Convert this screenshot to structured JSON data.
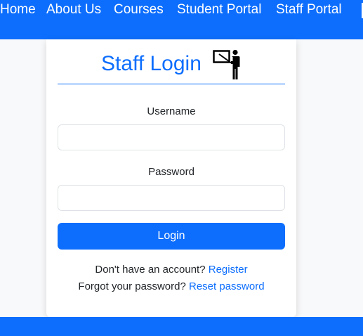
{
  "nav": {
    "items": [
      "Home",
      "About Us",
      "Courses",
      "Student Portal",
      "Staff Portal"
    ]
  },
  "login": {
    "title": "Staff Login",
    "icon": "teacher-at-board-icon",
    "username_label": "Username",
    "username_value": "",
    "password_label": "Password",
    "password_value": "",
    "button_label": "Login",
    "register_prompt": "Don't have an account?",
    "register_link": "Register",
    "forgot_prompt": "Forgot your password?",
    "reset_link": "Reset password"
  },
  "colors": {
    "primary": "#0d6efd",
    "page_bg": "#f8f9fa"
  }
}
